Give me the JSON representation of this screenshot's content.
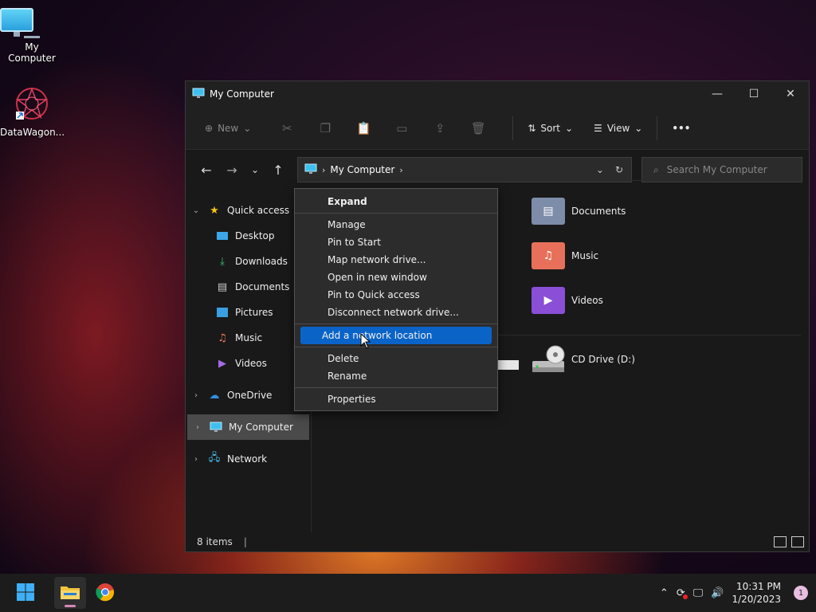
{
  "desktop": {
    "icons": [
      {
        "label": "My Computer"
      },
      {
        "label": "DataWagon..."
      }
    ]
  },
  "window": {
    "title": "My Computer",
    "controls": {
      "minimize": "—",
      "maximize": "☐",
      "close": "✕"
    }
  },
  "toolbar": {
    "new_label": "New",
    "sort_label": "Sort",
    "view_label": "View",
    "more_label": "•••"
  },
  "address": {
    "crumb": "My Computer"
  },
  "search": {
    "placeholder": "Search My Computer"
  },
  "sidebar": {
    "items": [
      {
        "label": "Quick access"
      },
      {
        "label": "Desktop"
      },
      {
        "label": "Downloads"
      },
      {
        "label": "Documents"
      },
      {
        "label": "Pictures"
      },
      {
        "label": "Music"
      },
      {
        "label": "Videos"
      },
      {
        "label": "OneDrive"
      },
      {
        "label": "My Computer"
      },
      {
        "label": "Network"
      }
    ]
  },
  "content": {
    "tiles": [
      {
        "label": "Documents"
      },
      {
        "label": "Music"
      },
      {
        "label": "Videos"
      },
      {
        "label": "CD Drive (D:)"
      }
    ]
  },
  "context_menu": {
    "items": [
      {
        "label": "Expand"
      },
      {
        "label": "Manage"
      },
      {
        "label": "Pin to Start"
      },
      {
        "label": "Map network drive..."
      },
      {
        "label": "Open in new window"
      },
      {
        "label": "Pin to Quick access"
      },
      {
        "label": "Disconnect network drive..."
      },
      {
        "label": "Add a network location"
      },
      {
        "label": "Delete"
      },
      {
        "label": "Rename"
      },
      {
        "label": "Properties"
      }
    ]
  },
  "status": {
    "items_count": "8 items"
  },
  "taskbar": {
    "time": "10:31 PM",
    "date": "1/20/2023",
    "notification_count": "1"
  },
  "colors": {
    "accent": "#0a64c8",
    "window_bg": "#191919",
    "taskbar_bg": "#1c1c1c"
  }
}
